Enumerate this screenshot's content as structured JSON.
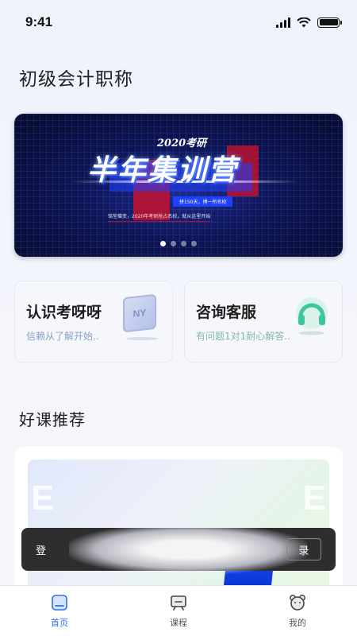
{
  "status_bar": {
    "time": "9:41"
  },
  "page": {
    "title": "初级会计职称"
  },
  "banner": {
    "small_title": "2020考研",
    "main_title": "半年集训营",
    "tagline": "拼150天，搏一所名校",
    "subline": "铭笙蝶变，2020年考研抢占名校，就从这里开始",
    "slide_count": 4,
    "active_slide": 1
  },
  "cards": [
    {
      "title": "认识考呀呀",
      "subtitle": "信赖从了解开始..",
      "icon_name": "ny-logo-icon",
      "icon_text": "NY"
    },
    {
      "title": "咨询客服",
      "subtitle": "有问题1对1耐心解答..",
      "icon_name": "headset-icon"
    }
  ],
  "section": {
    "title": "好课推荐"
  },
  "course": {
    "thumb_letter_left": "E",
    "thumb_letter_right": "E"
  },
  "toast": {
    "left_text": "登",
    "button_label": "录"
  },
  "tabs": [
    {
      "label": "首页",
      "icon": "home-icon",
      "active": true
    },
    {
      "label": "课程",
      "icon": "course-board-icon",
      "active": false
    },
    {
      "label": "我的",
      "icon": "bear-profile-icon",
      "active": false
    }
  ],
  "colors": {
    "accent": "#2e6ff2",
    "banner_red": "#c5122d",
    "banner_blue": "#1e40ff"
  }
}
